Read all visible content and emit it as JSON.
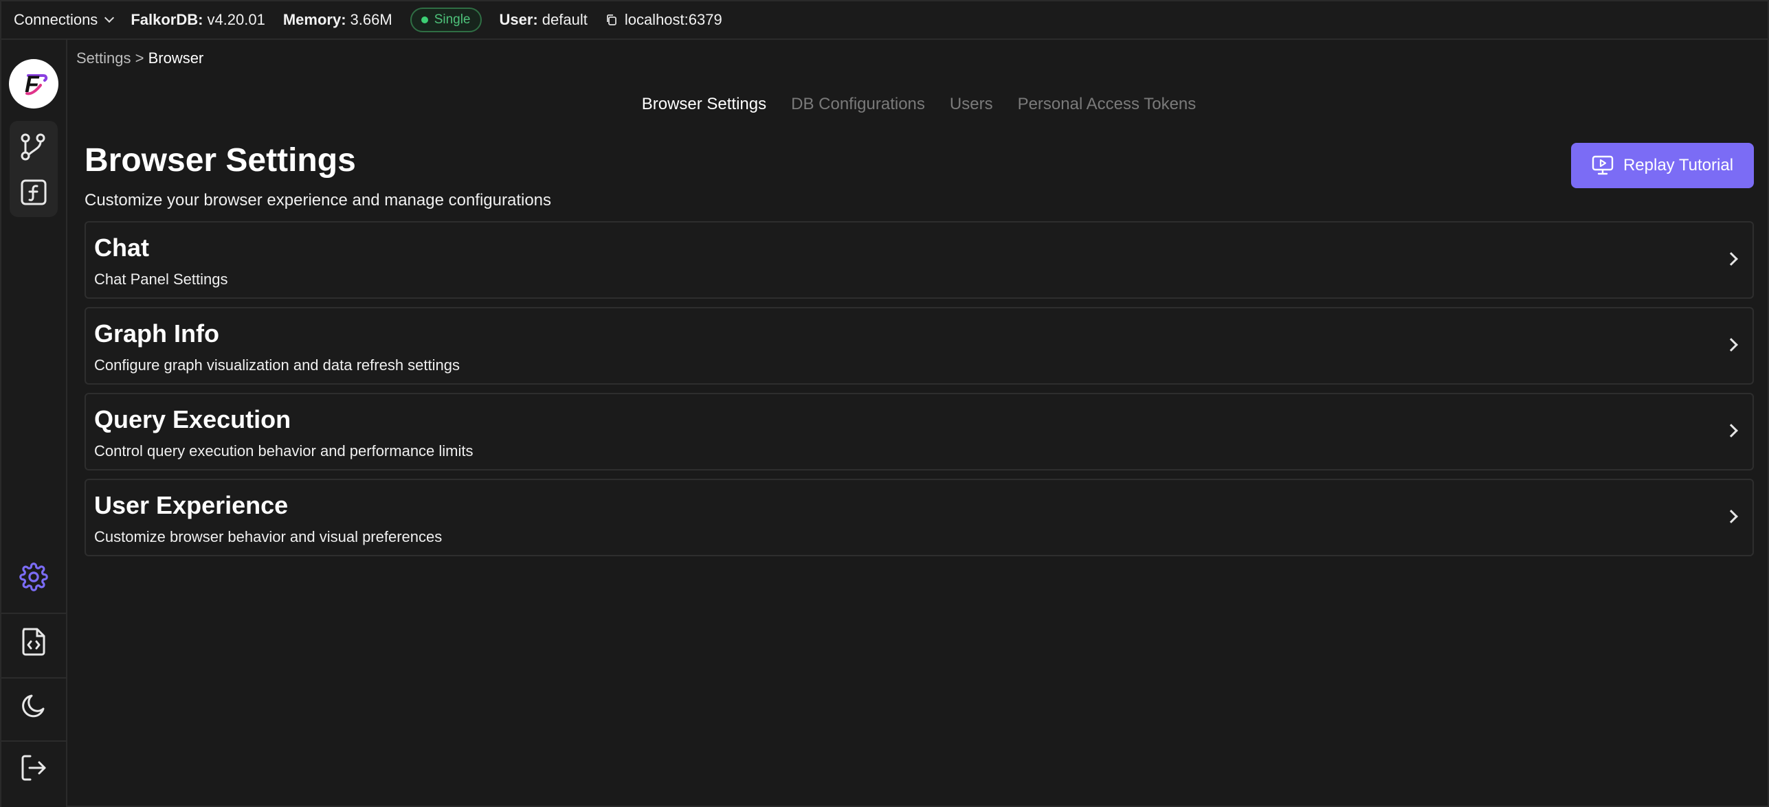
{
  "topbar": {
    "connections_label": "Connections",
    "db_label": "FalkorDB:",
    "db_version": "v4.20.01",
    "memory_label": "Memory:",
    "memory_value": "3.66M",
    "mode_badge": "Single",
    "user_label": "User:",
    "user_value": "default",
    "host": "localhost:6379"
  },
  "sidebar": {
    "logo_letter": "F",
    "icons": [
      "graph-icon",
      "function-icon",
      "gear-icon",
      "code-file-icon",
      "moon-icon",
      "logout-icon"
    ],
    "accent_color": "#7b6cf5"
  },
  "breadcrumb": {
    "parent": "Settings",
    "separator": " > ",
    "current": "Browser"
  },
  "tabs": [
    {
      "label": "Browser Settings",
      "active": true
    },
    {
      "label": "DB Configurations",
      "active": false
    },
    {
      "label": "Users",
      "active": false
    },
    {
      "label": "Personal Access Tokens",
      "active": false
    }
  ],
  "page": {
    "title": "Browser Settings",
    "subtitle": "Customize your browser experience and manage configurations",
    "replay_button": "Replay Tutorial"
  },
  "cards": [
    {
      "title": "Chat",
      "description": "Chat Panel Settings"
    },
    {
      "title": "Graph Info",
      "description": "Configure graph visualization and data refresh settings"
    },
    {
      "title": "Query Execution",
      "description": "Control query execution behavior and performance limits"
    },
    {
      "title": "User Experience",
      "description": "Customize browser behavior and visual preferences"
    }
  ]
}
